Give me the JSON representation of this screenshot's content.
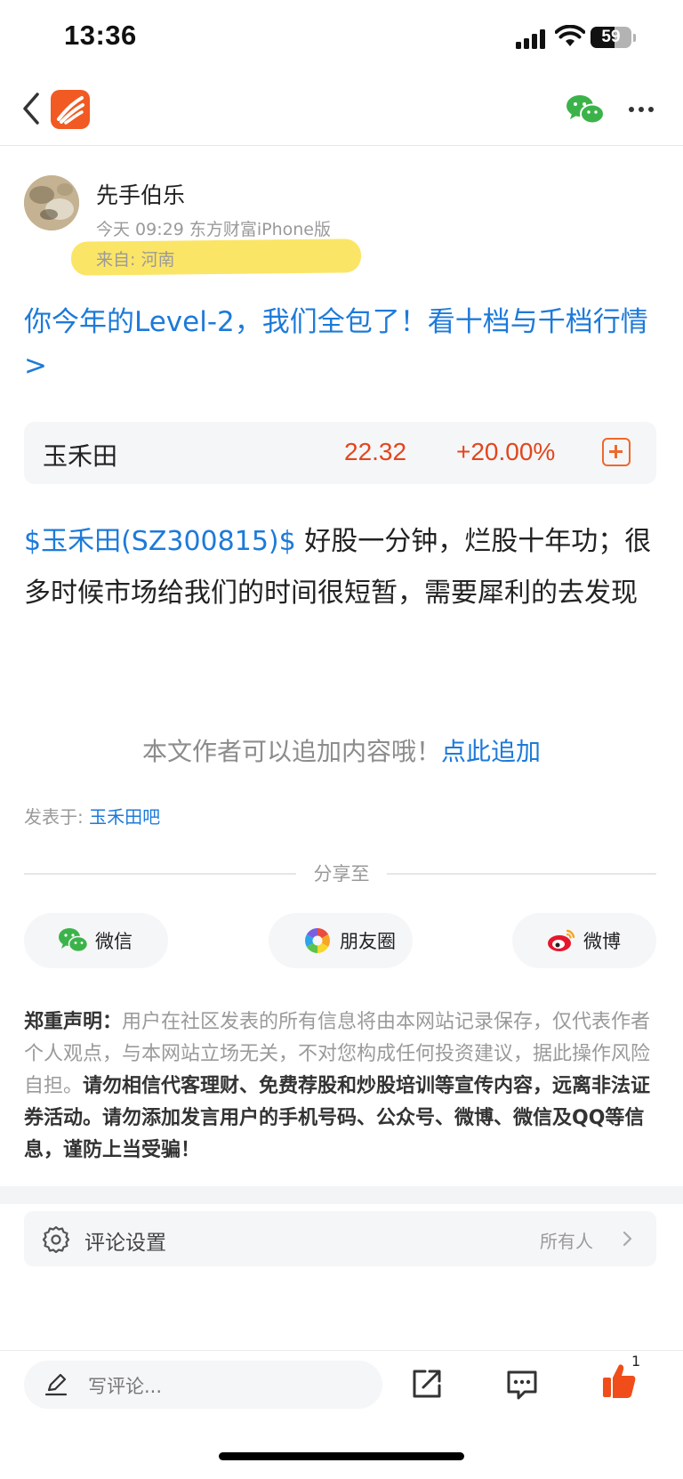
{
  "status_bar": {
    "time": "13:36",
    "battery_level": "59"
  },
  "nav": {
    "back_icon": "chevron-left-icon",
    "logo_icon": "eastmoney-logo-icon",
    "wechat_icon": "wechat-icon",
    "more_icon": "more-horizontal-icon"
  },
  "author": {
    "name": "先手伯乐",
    "meta": "今天 09:29 东方财富iPhone版",
    "location": "来自: 河南"
  },
  "promo": {
    "text": "你今年的Level-2，我们全包了！看十档与千档行情>"
  },
  "stock": {
    "name": "玉禾田",
    "price": "22.32",
    "change": "+20.00%"
  },
  "post": {
    "tag": "$玉禾田(SZ300815)$",
    "body": " 好股一分钟，烂股十年功；很多时候市场给我们的时间很短暂，需要犀利的去发现"
  },
  "append": {
    "hint": "本文作者可以追加内容哦！",
    "link": "点此追加"
  },
  "published_in": {
    "label": "发表于: ",
    "forum": "玉禾田吧"
  },
  "share": {
    "title": "分享至",
    "buttons": [
      {
        "label": "微信",
        "icon": "wechat-icon"
      },
      {
        "label": "朋友圈",
        "icon": "moments-icon"
      },
      {
        "label": "微博",
        "icon": "weibo-icon"
      }
    ]
  },
  "disclaimer": {
    "heading": "郑重声明：",
    "text1": "用户在社区发表的所有信息将由本网站记录保存，仅代表作者个人观点，与本网站立场无关，不对您构成任何投资建议，据此操作风险自担。",
    "text2": "请勿相信代客理财、免费荐股和炒股培训等宣传内容，远离非法证券活动。请勿添加发言用户的手机号码、公众号、微博、微信及QQ等信息，谨防上当受骗！"
  },
  "comment_settings": {
    "label": "评论设置",
    "value": "所有人"
  },
  "bottom_bar": {
    "comment_placeholder": "写评论...",
    "like_count": "1"
  },
  "colors": {
    "link_blue": "#1d7ad9",
    "rise_red": "#e2461c",
    "brand_orange": "#f15a22",
    "highlight_yellow": "#fbe35a"
  }
}
